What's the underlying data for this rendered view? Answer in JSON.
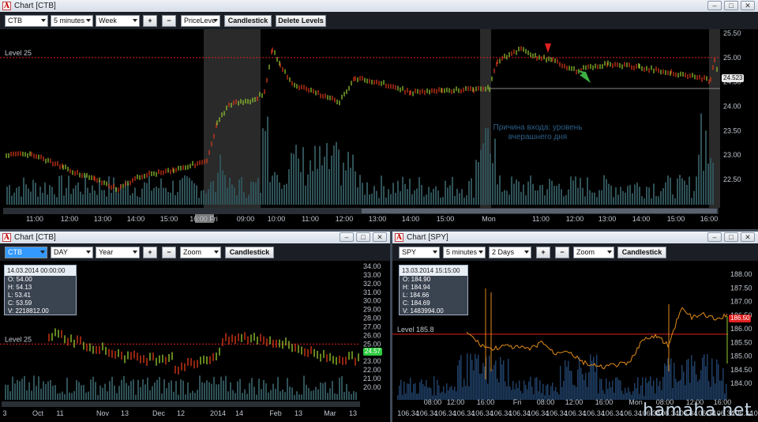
{
  "top": {
    "title": "Chart [CTB]",
    "symbol": "CTB",
    "interval": "5 minutes",
    "range": "Week",
    "plus": "+",
    "minus": "−",
    "mode": "PriceLeve",
    "candlestick": "Candlestick",
    "delete_levels": "Delete Levels",
    "level_label": "Level 25",
    "current_price": "24.523",
    "annotation_line1": "Причина входа: уровень",
    "annotation_line2": "вчерашнего дня",
    "y_ticks": [
      "25.50",
      "25.00",
      "24.50",
      "24.00",
      "23.50",
      "23.00",
      "22.50"
    ],
    "x_ticks": [
      "11:00",
      "12:00",
      "13:00",
      "14:00",
      "15:00",
      "16:00 Fri",
      "09:00",
      "10:00",
      "11:00",
      "12:00",
      "13:00",
      "14:00",
      "15:00",
      "Mon",
      "11:00",
      "12:00",
      "13:00",
      "14:00",
      "15:00",
      "16:00"
    ]
  },
  "bottom_left": {
    "title": "Chart [CTB]",
    "symbol": "CTB",
    "interval": "DAY",
    "range": "Year",
    "plus": "+",
    "minus": "−",
    "mode": "Zoom",
    "candlestick": "Candlestick",
    "level_label": "Level 25",
    "current_price": "24.57",
    "info": {
      "date": "14.03.2014 00:00:00",
      "open": "O: 54.00",
      "high": "H: 54.13",
      "low": "L: 53.41",
      "close": "C: 53.59",
      "volume": "V: 2218812.00"
    },
    "y_ticks": [
      "34.00",
      "33.00",
      "32.00",
      "31.00",
      "30.00",
      "29.00",
      "28.00",
      "27.00",
      "26.00",
      "25.00",
      "24.00",
      "23.00",
      "22.00",
      "21.00",
      "20.00"
    ],
    "x_ticks": [
      "3",
      "Oct",
      "11",
      "Nov",
      "13",
      "Dec",
      "12",
      "2014",
      "14",
      "Feb",
      "13",
      "Mar",
      "13"
    ]
  },
  "bottom_right": {
    "title": "Chart [SPY]",
    "symbol": "SPY",
    "interval": "5 minutes",
    "range": "2 Days",
    "plus": "+",
    "minus": "−",
    "mode": "Zoom",
    "candlestick": "Candlestick",
    "level_label": "Level 185.8",
    "current_price": "186.50",
    "info": {
      "date": "13.03.2014 15:15:00",
      "open": "O: 184.90",
      "high": "H: 184.94",
      "low": "L: 184.66",
      "close": "C: 184.69",
      "volume": "V: 1483994.00"
    },
    "y_ticks": [
      "188.00",
      "187.50",
      "187.00",
      "186.50",
      "186.00",
      "185.50",
      "185.00",
      "184.50",
      "184.00"
    ],
    "x_ticks": [
      "08:00",
      "12:00",
      "16:00",
      "Fri",
      "08:00",
      "12:00",
      "16:00",
      "Mon",
      "08:00",
      "12:00",
      "16:00"
    ],
    "bottom_values": [
      "106.34",
      "106.34",
      "106.34",
      "106.34",
      "106.34",
      "106.34",
      "106.34",
      "106.34",
      "106.34",
      "106.34",
      "106.34",
      "106.34",
      "106.34",
      "106.34",
      "106.34",
      "106.34",
      "106.34",
      "106.34",
      "106.34",
      "106.34"
    ]
  },
  "watermark": "hamaha.net",
  "colors": {
    "level": "#e02020",
    "volume": "#2f5258",
    "volume_spy": "#1f3f66",
    "up": "#9acd32",
    "down": "#e03a1a",
    "spy_line": "#e08a1a"
  }
}
